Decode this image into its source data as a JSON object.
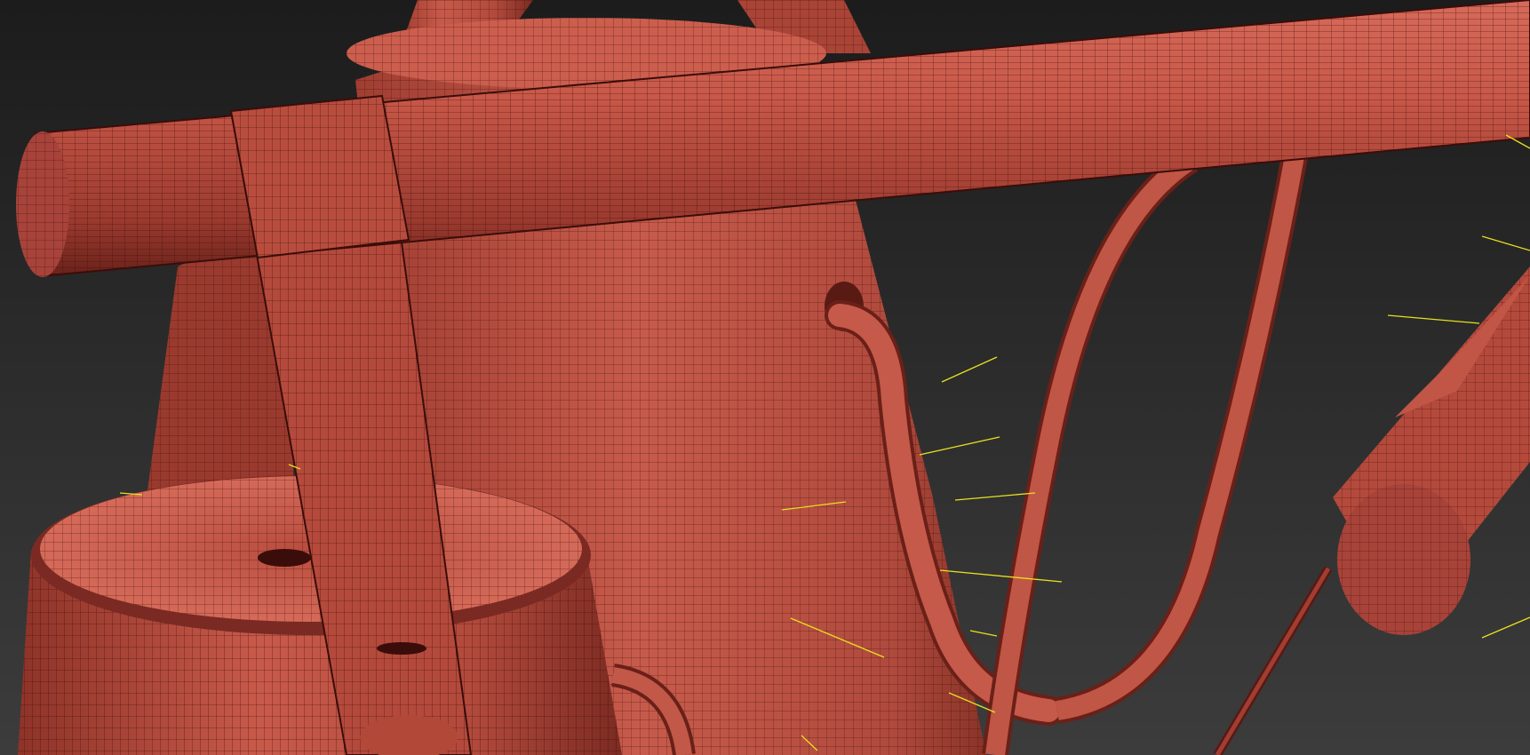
{
  "viewport": {
    "mode": "wireframe-shaded",
    "background_top": "#1c1c1c",
    "background_bottom": "#3a3a3a",
    "mesh_color": "#c4564a",
    "mesh_shadow": "#7a2a22",
    "wire_color": "#3a0d0a",
    "normal_line_color": "#e8e020"
  },
  "objects": [
    {
      "name": "horizontal-beam"
    },
    {
      "name": "beam-cap"
    },
    {
      "name": "vertical-strap"
    },
    {
      "name": "conical-body"
    },
    {
      "name": "bucket-cylinder"
    },
    {
      "name": "bent-pipe-left"
    },
    {
      "name": "loop-pipe-right"
    },
    {
      "name": "small-handle-pipe"
    },
    {
      "name": "right-cylinder"
    },
    {
      "name": "diagonal-rod"
    }
  ]
}
